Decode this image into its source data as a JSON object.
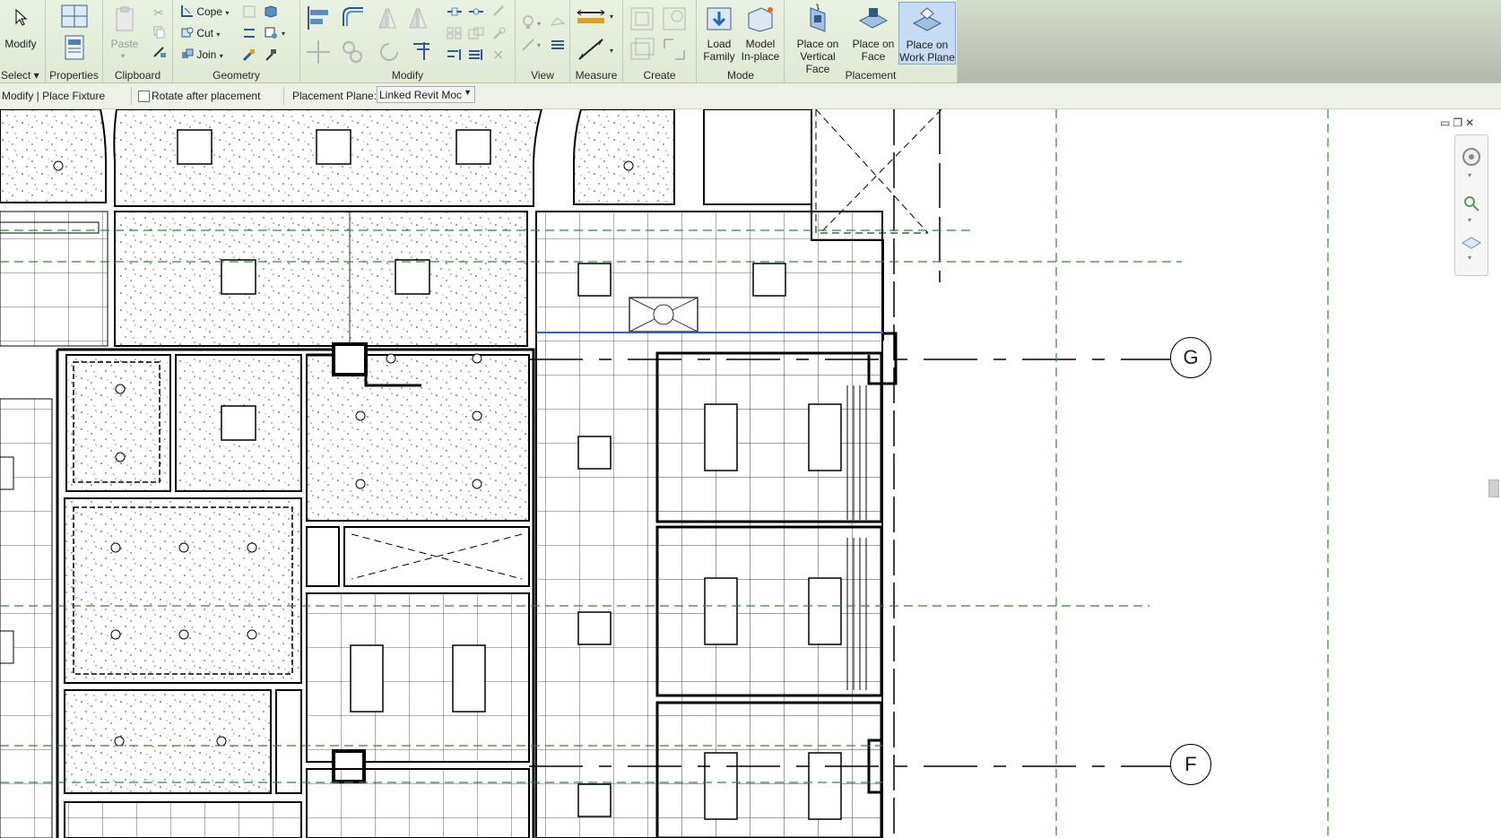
{
  "ribbon": {
    "select": {
      "modify_label": "Modify",
      "title": "Select ▾"
    },
    "properties": {
      "title": "Properties"
    },
    "clipboard": {
      "paste_label": "Paste",
      "title": "Clipboard"
    },
    "geometry": {
      "cope_label": "Cope",
      "cut_label": "Cut",
      "join_label": "Join",
      "title": "Geometry"
    },
    "modify": {
      "title": "Modify"
    },
    "view": {
      "title": "View"
    },
    "measure": {
      "title": "Measure"
    },
    "create": {
      "title": "Create"
    },
    "mode": {
      "load_family_label": "Load\nFamily",
      "model_inplace_label": "Model\nIn-place",
      "title": "Mode"
    },
    "placement": {
      "vertical_face_label": "Place on\nVertical Face",
      "face_label": "Place on\nFace",
      "work_plane_label": "Place on\nWork Plane",
      "title": "Placement"
    }
  },
  "options_bar": {
    "context": "Modify | Place Fixture",
    "rotate_label": "Rotate after placement",
    "placement_plane_label": "Placement Plane:",
    "placement_plane_value": "Linked Revit Moc"
  },
  "drawing": {
    "grid_g": "G",
    "grid_f": "F"
  },
  "colors": {
    "ribbon_bg": "#e3ecd9",
    "selected_tool": "#c6dcf3",
    "reference_plane": "#2e8b2e",
    "selection_line": "#2f5fd0"
  }
}
